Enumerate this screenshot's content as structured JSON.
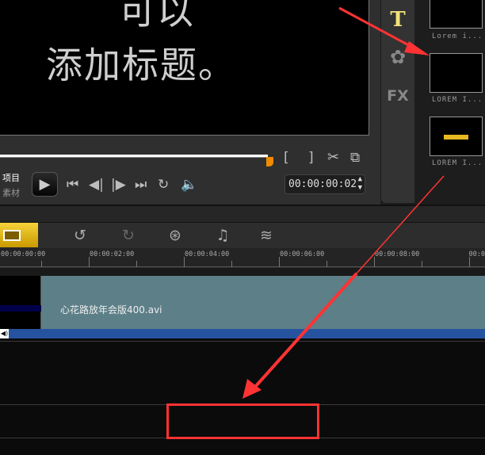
{
  "preview": {
    "line1": "可以",
    "line2": "添加标题。"
  },
  "player": {
    "mode_project": "项目",
    "mode_clip": "素材",
    "mark_in": "[",
    "mark_out": "]",
    "timecode": "00:00:00:02",
    "progress_percent": 72
  },
  "library": {
    "tabs": [
      {
        "name": "title",
        "label": "T"
      },
      {
        "name": "graphics",
        "label": "✿"
      },
      {
        "name": "fx",
        "label": "FX"
      }
    ],
    "items": [
      {
        "label": "Lorem i..."
      },
      {
        "label": "LOREM I..."
      },
      {
        "label": "LOREM I..."
      }
    ]
  },
  "timeline": {
    "ruler": [
      "00:00:00:00",
      "00:00:02:00",
      "00:00:04:00",
      "00:00:06:00",
      "00:00:08:00",
      "00:0"
    ],
    "clip_name": "心花路放年会版400.avi"
  },
  "colors": {
    "accent": "#f08a00",
    "annotation": "#ff3333",
    "clip": "#5c7f88",
    "audio": "#2553a0"
  }
}
